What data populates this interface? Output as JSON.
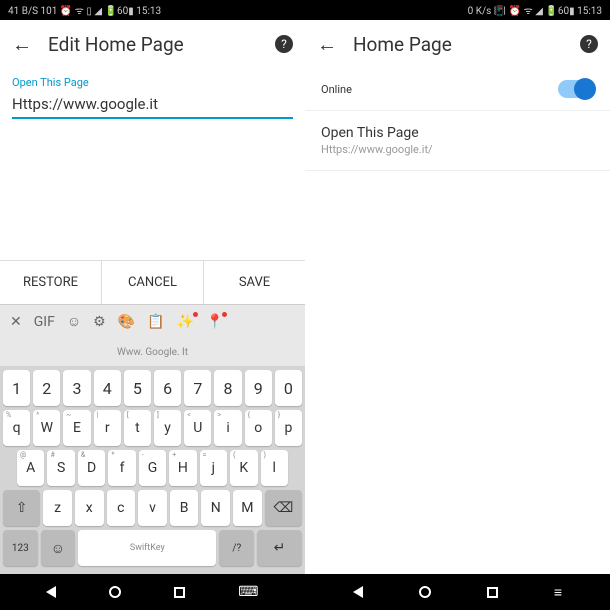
{
  "status": {
    "left": "41 B/S 101 ⏰ ᯤ ▯ ◢ 🔋60▮ 15:13",
    "right": "0 K/s 📳 ⏰ ᯤ ◢ 🔋60▮ 15:13"
  },
  "left_screen": {
    "title": "Edit Home Page",
    "field_label": "Open This Page",
    "url_value": "Https://www.google.it",
    "actions": {
      "restore": "RESTORE",
      "cancel": "CANCEL",
      "save": "SAVE"
    },
    "keyboard": {
      "suggestion": "Www. Google. It",
      "brand": "SwiftKey",
      "row1": [
        "1",
        "2",
        "3",
        "4",
        "5",
        "6",
        "7",
        "8",
        "9",
        "0"
      ],
      "row2_sub": [
        "%",
        "^",
        "~",
        "|",
        "[",
        "]",
        "<",
        ">",
        "{",
        "}"
      ],
      "row2": [
        "q",
        "W",
        "E",
        "r",
        "t",
        "y",
        "U",
        "i",
        "o",
        "p"
      ],
      "row3_sub": [
        "@",
        "#",
        "&",
        "*",
        "-",
        "+",
        "=",
        "(",
        ")"
      ],
      "row3": [
        "A",
        "S",
        "D",
        "f",
        "G",
        "H",
        "j",
        "K",
        "l"
      ],
      "row4": [
        "z",
        "x",
        "c",
        "v",
        "B",
        "N",
        "M"
      ],
      "num_key": "123"
    }
  },
  "right_screen": {
    "title": "Home Page",
    "toggle_label": "Online",
    "link_title": "Open This Page",
    "link_url": "Https://www.google.it/"
  }
}
